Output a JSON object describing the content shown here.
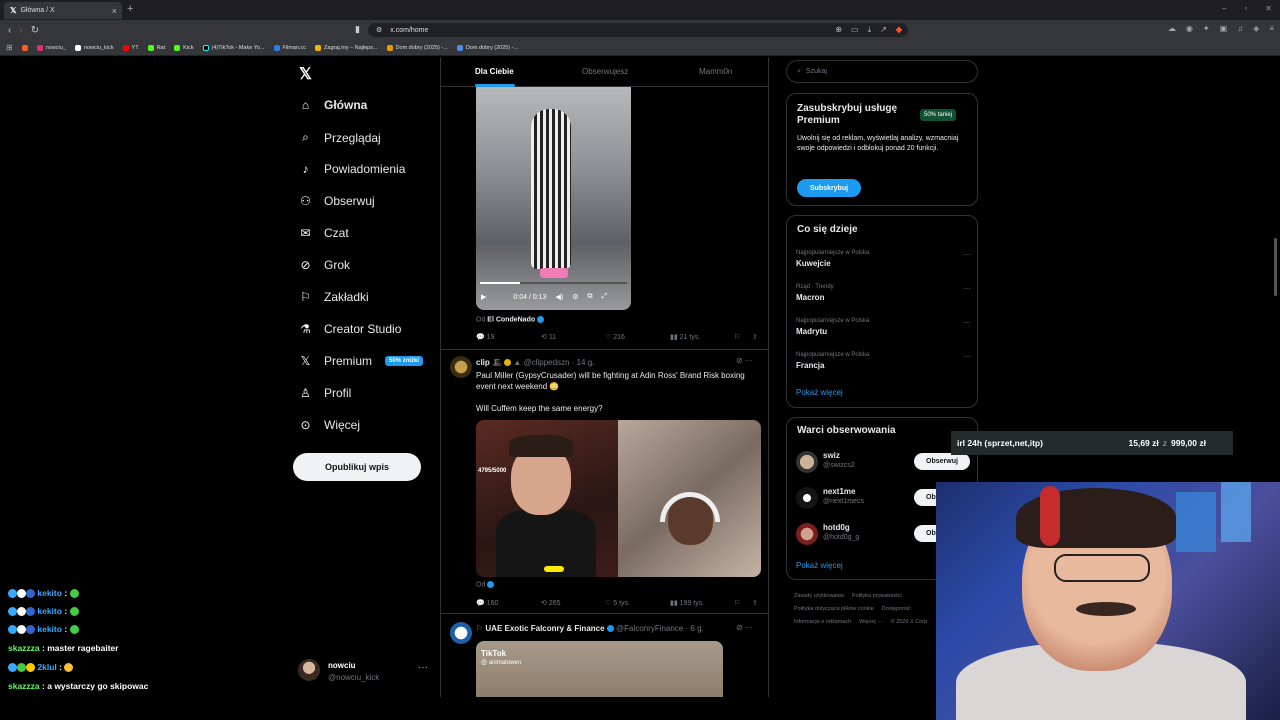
{
  "browser": {
    "tab_title": "Główna / X",
    "url": "x.com/home",
    "bookmarks": [
      "nowciu_",
      "nowciu_kick",
      "YT",
      "Rat",
      "Kick",
      "(4)TikTok - Make Yo...",
      "Filman.cc",
      "Zagraj.my – Najleps...",
      "Dom dobry (2025) -...",
      "Dom dobry (2025) -..."
    ]
  },
  "nav": {
    "items": [
      "Główna",
      "Przeglądaj",
      "Powiadomienia",
      "Obserwuj",
      "Czat",
      "Grok",
      "Zakładki",
      "Creator Studio",
      "Premium",
      "Profil",
      "Więcej"
    ],
    "premium_badge": "50% zniżki",
    "post_button": "Opublikuj wpis",
    "profile_name": "nowciu",
    "profile_handle": "@nowciu_kick"
  },
  "feed": {
    "tabs": [
      "Dla Ciebie",
      "Obserwujesz",
      "Mamm0n"
    ],
    "post1": {
      "video_time": "0:04 / 0:13",
      "source_prefix": "Od",
      "source_name": "El CondeNado",
      "replies": "19",
      "reposts": "11",
      "likes": "216",
      "views": "21 tys."
    },
    "post2": {
      "name": "clip",
      "handle": "@clippedszn",
      "age": "· 14 g.",
      "text1": "Paul Miller (GypsyCrusader) will be fighting at Adin Ross' Brand Risk boxing event next weekend 😳",
      "text2": "Will Cuffem keep the same energy?",
      "counter": "4795/5000",
      "source_prefix": "Od",
      "replies": "160",
      "reposts": "265",
      "likes": "5 tys.",
      "views": "199 tys."
    },
    "post3": {
      "name": "UAE Exotic Falconry & Finance",
      "handle": "@FalconryFinance",
      "age": "· 6 g.",
      "tiktok_logo": "TikTok",
      "tiktok_user": "@ animatowen"
    }
  },
  "sidebar": {
    "search_placeholder": "Szukaj",
    "premium": {
      "title": "Zasubskrybuj usługę Premium",
      "badge": "50% taniej",
      "desc": "Uwolnij się od reklam, wyświetlaj analizy, wzmacniaj swoje odpowiedzi i odblokuj ponad 20 funkcji.",
      "button": "Subskrybuj"
    },
    "trends_title": "Co się dzieje",
    "trends": [
      {
        "cat": "Najpopularniejsze w Polska",
        "name": "Kuwejcie"
      },
      {
        "cat": "Rząd · Trendy",
        "name": "Macron"
      },
      {
        "cat": "Najpopularniejsze w Polska",
        "name": "Madrytu"
      },
      {
        "cat": "Najpopularniejsze w Polska",
        "name": "Francja"
      }
    ],
    "show_more": "Pokaż więcej",
    "follow_title": "Warci obserwowania",
    "follows": [
      {
        "name": "swiz",
        "handle": "@swizcs2",
        "button": "Obserwuj"
      },
      {
        "name": "next1me",
        "handle": "@next1mecs",
        "button": "Obserwuj"
      },
      {
        "name": "hotd0g",
        "handle": "@hotd0g_g",
        "button": "Obserwuj"
      }
    ],
    "footer": [
      "Zasady użytkowania",
      "Polityka prywatności",
      "Polityka dotycząca plików cookie",
      "Dostępność",
      "Informacje o reklamach",
      "Więcej ···",
      "© 2026 X Corp."
    ]
  },
  "overlay": {
    "donation_label": "irl 24h (sprzet,net,itp)",
    "donation_current": "15,69 zł",
    "donation_sep": "z",
    "donation_goal": "999,00 zł"
  },
  "chat": [
    {
      "user": "kekito",
      "msg": ""
    },
    {
      "user": "kekito",
      "msg": ""
    },
    {
      "user": "kekito",
      "msg": ""
    },
    {
      "user": "skazzza",
      "msg": "master ragebaiter"
    },
    {
      "user": "2klul",
      "msg": ""
    },
    {
      "user": "skazzza",
      "msg": "a wystarczy go skipowac"
    }
  ]
}
